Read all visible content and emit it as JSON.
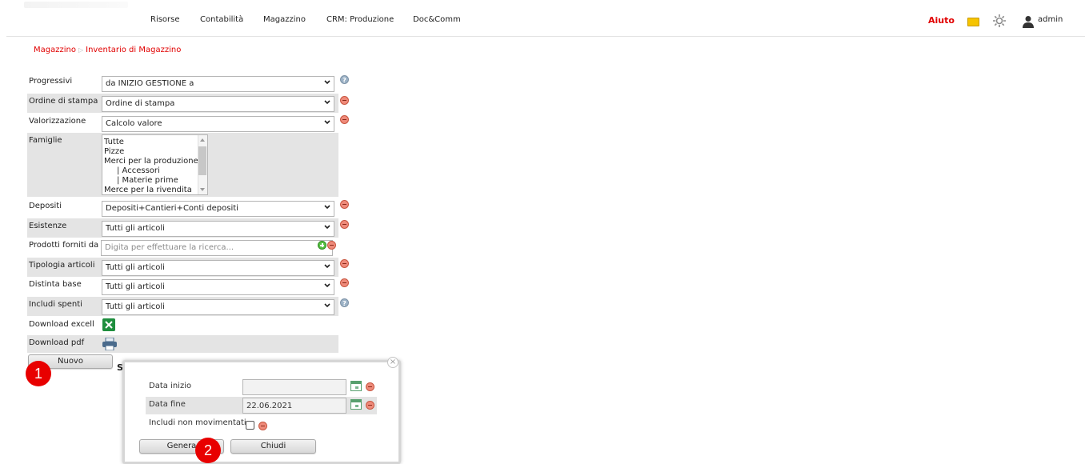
{
  "nav": {
    "items": [
      "Risorse",
      "Contabilità",
      "Magazzino",
      "CRM: Produzione",
      "Doc&Comm"
    ],
    "help": "Aiuto",
    "user": "admin"
  },
  "breadcrumb": {
    "section": "Magazzino",
    "page": "Inventario di Magazzino"
  },
  "form": {
    "progressivi": {
      "label": "Progressivi",
      "value": "da INIZIO GESTIONE a"
    },
    "ordine": {
      "label": "Ordine di stampa",
      "value": "Ordine di stampa"
    },
    "valorizzazione": {
      "label": "Valorizzazione",
      "value": "Calcolo valore"
    },
    "famiglie": {
      "label": "Famiglie",
      "options": [
        "Tutte",
        "Pizze",
        "Merci per la produzione",
        "| Accessori",
        "| Materie prime",
        "Merce per la rivendita"
      ]
    },
    "depositi": {
      "label": "Depositi",
      "value": "Depositi+Cantieri+Conti depositi"
    },
    "esistenze": {
      "label": "Esistenze",
      "value": "Tutti gli articoli"
    },
    "prodotti": {
      "label": "Prodotti forniti da",
      "placeholder": "Digita per effettuare la ricerca..."
    },
    "tipologia": {
      "label": "Tipologia articoli",
      "value": "Tutti gli articoli"
    },
    "distinta": {
      "label": "Distinta base",
      "value": "Tutti gli articoli"
    },
    "spenti": {
      "label": "Includi spenti",
      "value": "Tutti gli articoli"
    },
    "excel": {
      "label": "Download excell"
    },
    "pdf": {
      "label": "Download pdf"
    }
  },
  "buttons": {
    "nuovo": "Nuovo",
    "s_letter": "S"
  },
  "badges": {
    "one": "1",
    "two": "2"
  },
  "dialog": {
    "data_inizio": {
      "label": "Data inizio",
      "value": ""
    },
    "data_fine": {
      "label": "Data fine",
      "value": "22.06.2021"
    },
    "includi": {
      "label": "Includi non movimentati",
      "checked": false
    },
    "genera": "Genera",
    "chiudi": "Chiudi",
    "close": "×"
  },
  "colors": {
    "accent_red": "#e10000",
    "badge_red": "#e80000",
    "row_shade": "#e4e4e4",
    "note_yellow": "#f6c400"
  },
  "icons": [
    "note-icon",
    "gear-icon",
    "user-icon",
    "chevron-down-icon",
    "help-icon",
    "remove-icon",
    "add-icon",
    "excel-icon",
    "printer-icon",
    "calendar-icon",
    "close-icon"
  ]
}
